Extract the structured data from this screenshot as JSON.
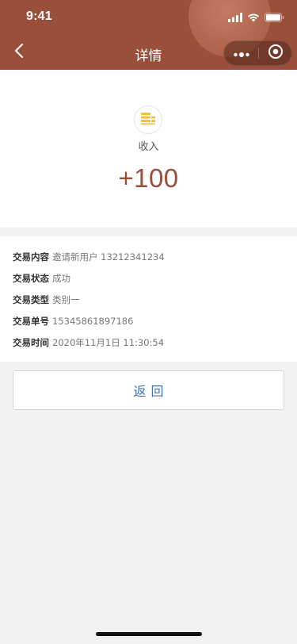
{
  "status_bar": {
    "time": "9:41"
  },
  "nav": {
    "title": "详情",
    "back_icon": "chevron-left-icon",
    "more_icon": "more-dots-icon",
    "close_icon": "target-icon"
  },
  "summary": {
    "icon": "coin-stack-icon",
    "type_label": "收入",
    "amount": "+100"
  },
  "details": [
    {
      "label": "交易内容",
      "value": "邀请新用户 13212341234"
    },
    {
      "label": "交易状态",
      "value": "成功"
    },
    {
      "label": "交易类型",
      "value": "类别一"
    },
    {
      "label": "交易单号",
      "value": "15345861897186"
    },
    {
      "label": "交易时间",
      "value": "2020年11月1日 11:30:54"
    }
  ],
  "actions": {
    "back_label": "返回"
  },
  "colors": {
    "header": "#9a4f3b",
    "amount": "#9a4f3b",
    "button_text": "#3d6fb6",
    "icon_accent": "#f2c13a",
    "page_background": "#f2f2f2"
  }
}
